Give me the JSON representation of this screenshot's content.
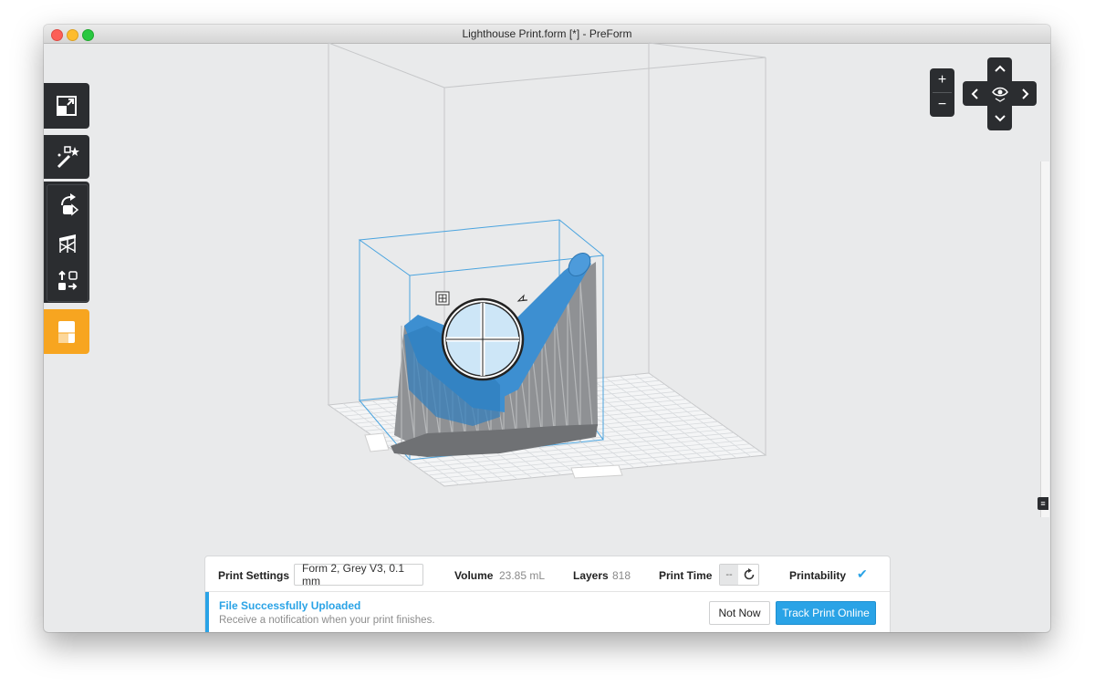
{
  "window": {
    "title": "Lighthouse Print.form [*] - PreForm"
  },
  "toolbar": {
    "tools": [
      {
        "id": "scale-to-fit",
        "icon": "expand-icon"
      },
      {
        "id": "one-click-print",
        "icon": "magic-wand-icon"
      },
      {
        "id": "orientation",
        "icon": "orient-icon"
      },
      {
        "id": "supports",
        "icon": "supports-icon"
      },
      {
        "id": "layout",
        "icon": "layout-icon"
      },
      {
        "id": "print",
        "icon": "printer-icon"
      }
    ]
  },
  "nav": {
    "zoom_in": "+",
    "zoom_out": "−",
    "up": "^",
    "left": "<",
    "right": ">",
    "down": "v"
  },
  "print_settings": {
    "label": "Print Settings",
    "value": "Form 2, Grey V3, 0.1 mm",
    "volume_label": "Volume",
    "volume_value": "23.85 mL",
    "layers_label": "Layers",
    "layers_value": "818",
    "print_time_label": "Print Time",
    "print_time_value": "--",
    "printability_label": "Printability",
    "printability_icon": "check-icon"
  },
  "notification": {
    "title": "File Successfully Uploaded",
    "message": "Receive a notification when your print finishes.",
    "not_now": "Not Now",
    "track": "Track Print Online"
  },
  "colors": {
    "accent": "#2aa3e6",
    "toolbar": "#2b2d30",
    "active_tool": "#f7a520",
    "model": "#3d8fd1",
    "supports": "#8b8d90"
  }
}
